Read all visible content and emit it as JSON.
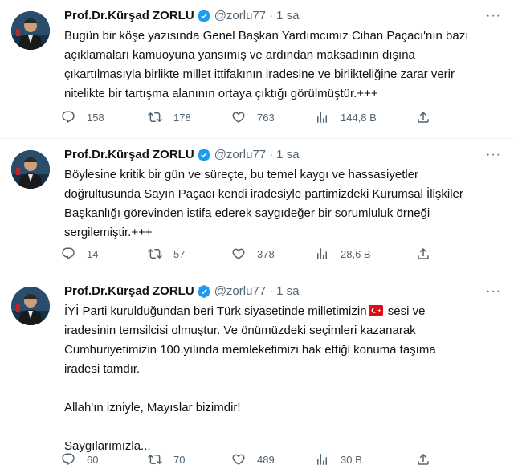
{
  "tweets": [
    {
      "author_name": "Prof.Dr.Kürşad ZORLU",
      "handle": "@zorlu77",
      "separator": "·",
      "time": "1 sa",
      "paragraphs": [
        "Bugün bir köşe yazısında Genel Başkan Yardımcımız Cihan Paçacı'nın bazı\naçıklamaları kamuoyuna yansımış ve ardından maksadının dışına\nçıkartılmasıyla birlikte millet ittifakının iradesine ve birlikteliğine zarar verir\nnitelikte bir tartışma alanının ortaya çıktığı görülmüştür.+++"
      ],
      "replies": "158",
      "retweets": "178",
      "likes": "763",
      "views": "144,8 B"
    },
    {
      "author_name": "Prof.Dr.Kürşad ZORLU",
      "handle": "@zorlu77",
      "separator": "·",
      "time": "1 sa",
      "paragraphs": [
        "Böylesine kritik bir gün ve süreçte, bu temel kaygı ve hassasiyetler\ndoğrultusunda Sayın Paçacı kendi iradesiyle partimizdeki Kurumsal İlişkiler\nBaşkanlığı görevinden istifa ederek saygıdeğer bir sorumluluk örneği\nsergilemiştir.+++"
      ],
      "replies": "14",
      "retweets": "57",
      "likes": "378",
      "views": "28,6 B"
    },
    {
      "author_name": "Prof.Dr.Kürşad ZORLU",
      "handle": "@zorlu77",
      "separator": "·",
      "time": "1 sa",
      "first_line_before_flag": "İYİ Parti kurulduğundan beri Türk siyasetinde milletimizin",
      "flag_icon": "turkey-flag-emoji",
      "first_line_after_flag": " sesi ve",
      "rest_of_paragraph": "iradesinin temsilcisi olmuştur. Ve önümüzdeki seçimleri kazanarak\nCumhuriyetimizin 100.yılında memleketimizi hak ettiği konuma taşıma\niradesi tamdır.",
      "paragraph_2": "Allah'ın izniyle, Mayıslar bizimdir!",
      "paragraph_3": "Saygılarımızla...",
      "replies": "60",
      "retweets": "70",
      "likes": "489",
      "views": "30 B"
    }
  ],
  "colors": {
    "text": "#0f1419",
    "secondary": "#536471",
    "verified": "#1d9bf0",
    "divider": "#eff3f4",
    "flag_red": "#e30a17"
  },
  "icons": [
    "reply-icon",
    "retweet-icon",
    "like-icon",
    "views-icon",
    "share-icon",
    "verified-badge-icon",
    "more-icon"
  ]
}
